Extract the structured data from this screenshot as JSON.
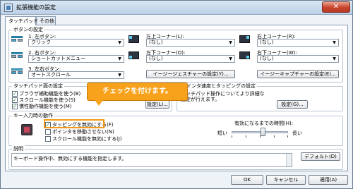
{
  "window": {
    "title": "拡張機能の設定",
    "close_symbol": "✕"
  },
  "tabs": [
    {
      "label": "タッチパッド"
    },
    {
      "label": "その他"
    }
  ],
  "button_settings": {
    "title": "ボタンの設定",
    "rows": [
      {
        "label": "1. 左ボタン:",
        "value": "クリック"
      },
      {
        "label": "2. 右ボタン:",
        "value": "ショートカットメニュー"
      },
      {
        "label": "3. 左右ボタン:",
        "value": "オートスクロール"
      }
    ],
    "corners": [
      {
        "label": "左上コーナー(L):",
        "value": "(なし)"
      },
      {
        "label": "右上コーナー(R):",
        "value": "(なし)"
      },
      {
        "label": "左下コーナー(O):",
        "value": "(なし)"
      },
      {
        "label": "右下コーナー(W):",
        "value": "(なし)"
      }
    ],
    "gesture_button": "イージージェスチャーの設定(Y)...",
    "easy_capture_button": "イージーキャプチャーの設定(E)..."
  },
  "touchpad_area": {
    "title": "タッチパッド面の設定",
    "checks": [
      {
        "label": "ブラウザ補助機能を使う(B)",
        "checked": true
      },
      {
        "label": "スクロール機能を使う(S)",
        "checked": true
      },
      {
        "label": "慣性動作機能を使う(M)",
        "checked": true
      }
    ],
    "settings_button": "設定(L)..."
  },
  "pointer_speed": {
    "title": "ポインタ速度とタッピングの設定",
    "description": "タッチパッド操作についてより詳細な設定が行えます。",
    "settings_button": "設定(G)..."
  },
  "key_input": {
    "title": "キー入力時の動作",
    "checks": [
      {
        "label": "タッピングを無効にする(F)",
        "checked": true
      },
      {
        "label": "ポインタを移動させない(N)",
        "checked": false
      },
      {
        "label": "スクロール機能を無効にする(J)",
        "checked": false
      }
    ],
    "time_label": "有効になるまでの時間(H):",
    "short_label": "短い",
    "long_label": "長い",
    "slider_value": 0.55
  },
  "description": {
    "title": "説明",
    "text": "キーボード操作中、無効にする機能を指定します。"
  },
  "default_button": "デフォルト(D)",
  "callout": {
    "text": "チェックを付けます。"
  },
  "footer": {
    "ok": "OK",
    "cancel": "キャンセル",
    "apply": "適用(A)"
  },
  "colors": {
    "callout": "#f7a21a",
    "highlight": "#f39a12",
    "title_bar": "#c9daec"
  }
}
